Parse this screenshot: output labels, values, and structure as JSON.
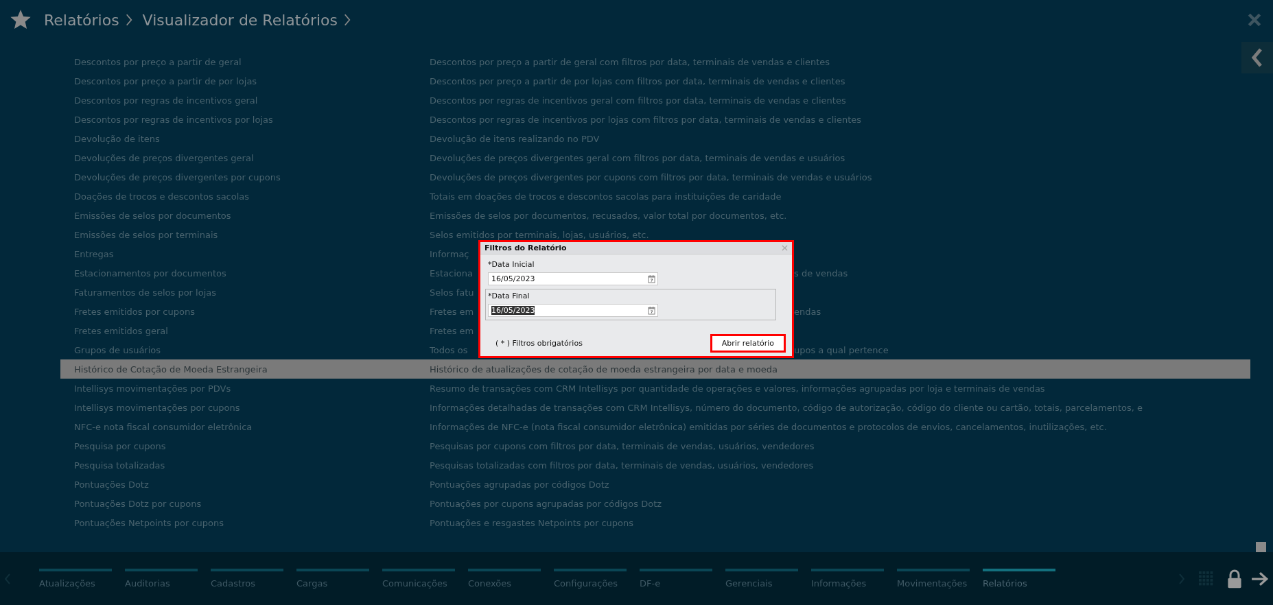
{
  "breadcrumb": [
    "Relatórios",
    "Visualizador de Relatórios"
  ],
  "reports": [
    {
      "name": "Descontos por preço a partir de geral",
      "description": "Descontos por preço a partir de geral com filtros por data, terminais de vendas e clientes",
      "selected": false
    },
    {
      "name": "Descontos por preço a partir de por lojas",
      "description": "Descontos por preço a partir de por lojas com filtros por data, terminais de vendas e clientes",
      "selected": false
    },
    {
      "name": "Descontos por regras de incentivos geral",
      "description": "Descontos por regras de incentivos geral com filtros por data, terminais de vendas e clientes",
      "selected": false
    },
    {
      "name": "Descontos por regras de incentivos por lojas",
      "description": "Descontos por regras de incentivos por lojas com filtros por data, terminais de vendas e clientes",
      "selected": false
    },
    {
      "name": "Devolução de itens",
      "description": "Devolução de itens realizando no PDV",
      "selected": false
    },
    {
      "name": "Devoluções de preços divergentes geral",
      "description": "Devoluções de preços divergentes geral com filtros por data, terminais de vendas e usuários",
      "selected": false
    },
    {
      "name": "Devoluções de preços divergentes por cupons",
      "description": "Devoluções de preços divergentes por cupons com filtros por data, terminais de vendas e usuários",
      "selected": false
    },
    {
      "name": "Doações de trocos e descontos sacolas",
      "description": "Totais em doações de trocos e descontos sacolas para instituições de caridade",
      "selected": false
    },
    {
      "name": "Emissões de selos por documentos",
      "description": "Emissões de selos por documentos, recusados, valor total por documentos, etc.",
      "selected": false
    },
    {
      "name": "Emissões de selos por terminais",
      "description": "Selos emitidos por terminais, lojas, usuários, etc.",
      "selected": false
    },
    {
      "name": "Entregas",
      "description": "Informaç",
      "selected": false
    },
    {
      "name": "Estacionamentos por documentos",
      "description": "Estaciona",
      "description_tail": "s de vendas",
      "selected": false
    },
    {
      "name": "Faturamentos de selos por lojas",
      "description": "Selos fatu",
      "selected": false
    },
    {
      "name": "Fretes emitidos por cupons",
      "description": "Fretes em",
      "description_tail": "endas",
      "selected": false
    },
    {
      "name": "Fretes emitidos geral",
      "description": "Fretes em",
      "selected": false
    },
    {
      "name": "Grupos de usuários",
      "description": "Todos os",
      "description_tail": "upos a qual pertence",
      "selected": false
    },
    {
      "name": "Histórico de Cotação de Moeda Estrangeira",
      "description": "Histórico de atualizações de cotação de moeda estrangeira por data e moeda",
      "selected": true
    },
    {
      "name": "Intellisys movimentações por PDVs",
      "description": "Resumo de transações com CRM Intellisys por quantidade de operações e valores, informações agrupadas por loja e terminais de vendas",
      "selected": false
    },
    {
      "name": "Intellisys movimentações por cupons",
      "description": "Informações detalhadas de transações com CRM Intellisys, número do documento, código de autorização, código do cliente ou cartão, totais, parcelamentos, e",
      "selected": false
    },
    {
      "name": "NFC-e nota fiscal consumidor eletrônica",
      "description": "Informações de NFC-e (nota fiscal consumidor eletrônica) emitidas por séries de documentos e protocolos de envios, cancelamentos, inutilizações, etc.",
      "selected": false
    },
    {
      "name": "Pesquisa por cupons",
      "description": "Pesquisas por cupons com filtros por data, terminais de vendas, usuários, vendedores",
      "selected": false
    },
    {
      "name": "Pesquisa totalizadas",
      "description": "Pesquisas totalizadas com filtros por data, terminais de vendas, usuários, vendedores",
      "selected": false
    },
    {
      "name": "Pontuações Dotz",
      "description": "Pontuações agrupadas por códigos Dotz",
      "selected": false
    },
    {
      "name": "Pontuações Dotz por cupons",
      "description": "Pontuações por cupons agrupadas por códigos Dotz",
      "selected": false
    },
    {
      "name": "Pontuações Netpoints por cupons",
      "description": "Pontuações e resgastes Netpoints por cupons",
      "selected": false
    }
  ],
  "dialog": {
    "title": "Filtros do Relatório",
    "highlighted": true,
    "fields": [
      {
        "label": "*Data Inicial",
        "value": "16/05/2023",
        "focused": false,
        "text_selected": false
      },
      {
        "label": "*Data Final",
        "value": "16/05/2023",
        "focused": true,
        "text_selected": true
      }
    ],
    "note": "( * ) Filtros obrigatórios",
    "button": {
      "label": "Abrir relatório",
      "highlighted": true
    }
  },
  "modules": [
    {
      "label": "Atualizações",
      "selected": false
    },
    {
      "label": "Auditorias",
      "selected": false
    },
    {
      "label": "Cadastros",
      "selected": false
    },
    {
      "label": "Cargas",
      "selected": false
    },
    {
      "label": "Comunicações",
      "selected": false
    },
    {
      "label": "Conexões",
      "selected": false
    },
    {
      "label": "Configurações",
      "selected": false
    },
    {
      "label": "DF-e",
      "selected": false
    },
    {
      "label": "Gerenciais",
      "selected": false
    },
    {
      "label": "Informações",
      "selected": false
    },
    {
      "label": "Movimentações",
      "selected": false
    },
    {
      "label": "Relatórios",
      "selected": true
    }
  ]
}
